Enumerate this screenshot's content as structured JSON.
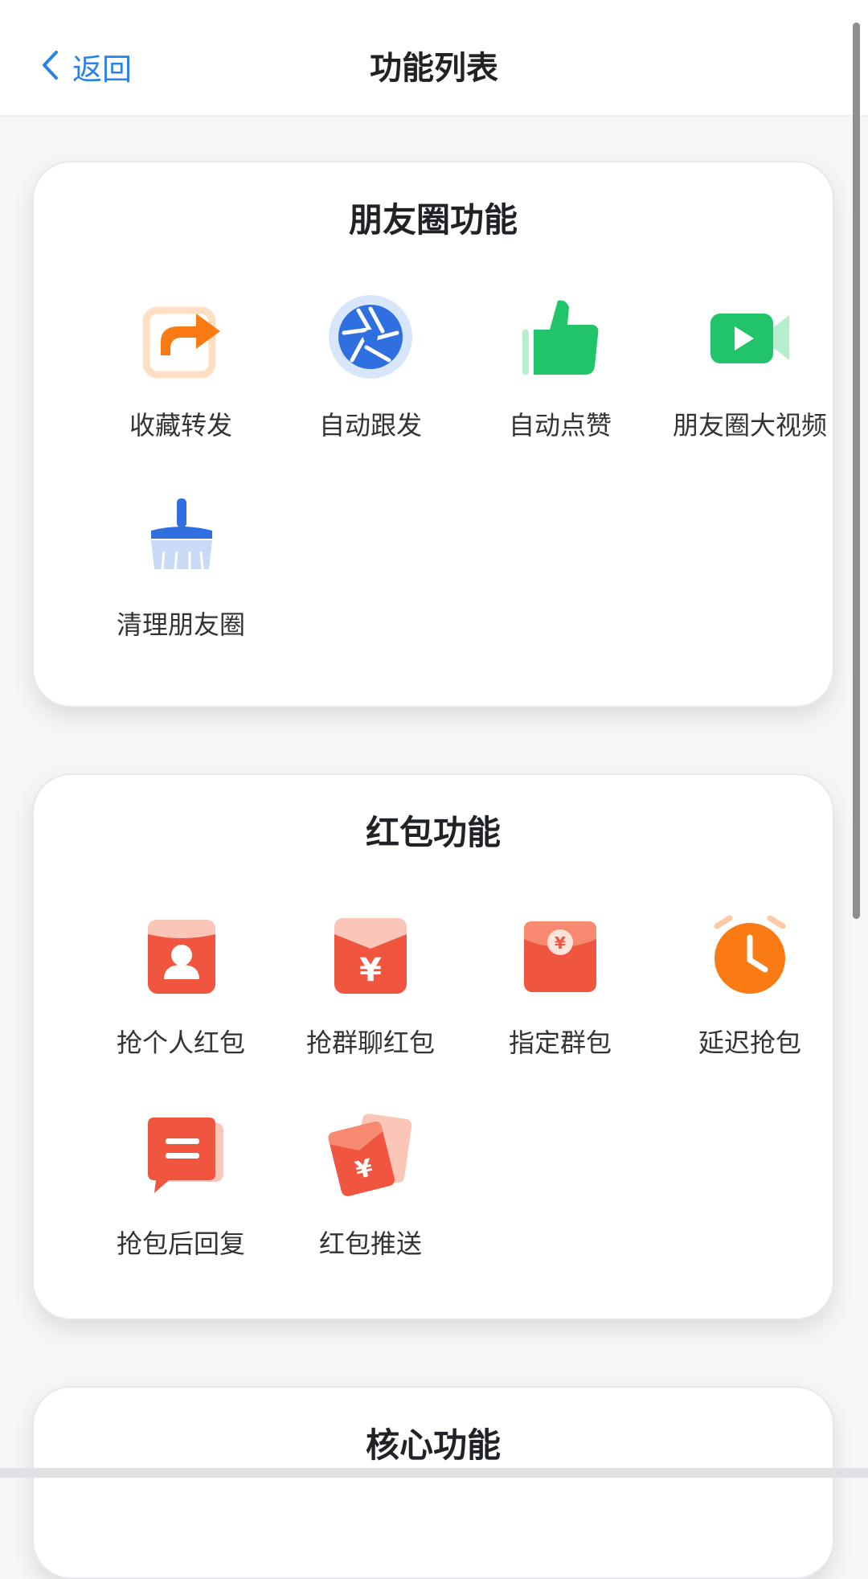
{
  "header": {
    "back_label": "返回",
    "title": "功能列表"
  },
  "sections": [
    {
      "title": "朋友圈功能",
      "items": [
        {
          "label": "收藏转发",
          "icon": "share-forward-icon"
        },
        {
          "label": "自动跟发",
          "icon": "camera-shutter-icon"
        },
        {
          "label": "自动点赞",
          "icon": "thumbs-up-icon"
        },
        {
          "label": "朋友圈大视频",
          "icon": "video-camera-icon"
        },
        {
          "label": "清理朋友圈",
          "icon": "broom-icon"
        }
      ]
    },
    {
      "title": "红包功能",
      "items": [
        {
          "label": "抢个人红包",
          "icon": "red-envelope-person-icon"
        },
        {
          "label": "抢群聊红包",
          "icon": "red-envelope-yen-icon"
        },
        {
          "label": "指定群包",
          "icon": "red-envelope-seal-icon"
        },
        {
          "label": "延迟抢包",
          "icon": "alarm-clock-icon"
        },
        {
          "label": "抢包后回复",
          "icon": "chat-bubble-icon"
        },
        {
          "label": "红包推送",
          "icon": "tilted-envelope-icon"
        }
      ]
    },
    {
      "title": "核心功能",
      "items": []
    }
  ],
  "colors": {
    "accent_blue": "#2a82e4",
    "orange": "#fa7a14",
    "green": "#22c46a",
    "red": "#f0553f"
  }
}
